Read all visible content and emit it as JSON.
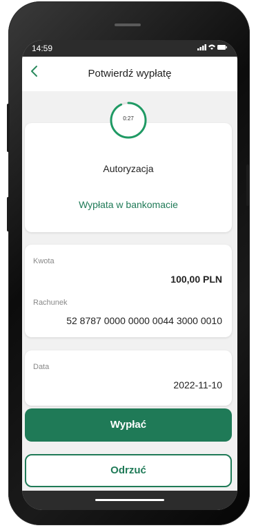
{
  "status_bar": {
    "time": "14:59",
    "icons_text": "▐▐▐ ◠ ▭",
    "icons": [
      "signal-icon",
      "wifi-icon",
      "battery-icon"
    ]
  },
  "header": {
    "title": "Potwierdź wypłatę",
    "back_icon": "chevron-left-icon"
  },
  "timer": {
    "label": "0:27",
    "progress": 0.93
  },
  "authorization": {
    "title": "Autoryzacja",
    "method": "Wypłata w bankomacie"
  },
  "details": {
    "amount_label": "Kwota",
    "amount_value": "100,00 PLN",
    "account_label": "Rachunek",
    "account_value": "52 8787 0000 0000 0044 3000 0010",
    "date_label": "Data",
    "date_value": "2022-11-10"
  },
  "actions": {
    "confirm_label": "Wypłać",
    "reject_label": "Odrzuć"
  },
  "colors": {
    "accent": "#1f7a57",
    "screen_bg": "#f1f1f1",
    "bar_dark": "#2c2c2c"
  }
}
